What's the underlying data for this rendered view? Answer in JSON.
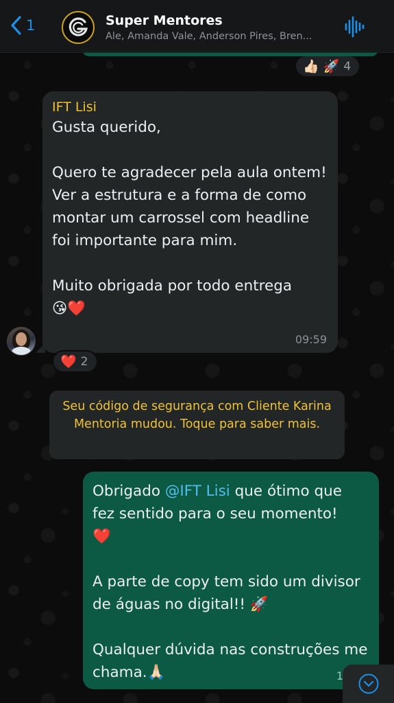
{
  "header": {
    "back_count": "1",
    "group_name": "Super Mentores",
    "participants": "Ale, Amanda Vale, Anderson Pires, Bren...",
    "colors": {
      "accent": "#1e90e8",
      "gold": "#c9a227"
    }
  },
  "top_reaction": {
    "emojis": "👍🏻 🚀",
    "count": "4"
  },
  "incoming_message": {
    "sender": "IFT Lisi",
    "text": "Gusta querido,\n\nQuero te agradecer pela aula ontem!\nVer a estrutura e a forma de como montar um carrossel com headline foi importante para mim.\n\nMuito obrigada por todo entrega\n😘❤️",
    "time": "09:59",
    "sender_color": "#f2c233"
  },
  "incoming_reaction": {
    "emoji": "❤️",
    "count": "2"
  },
  "system_note": {
    "text": "Seu código de segurança com Cliente Karina Mentoria mudou. Toque para saber mais."
  },
  "outgoing_message": {
    "prefix": "Obrigado ",
    "mention": "@IFT Lisi",
    "text": " que ótimo que fez sentido para o seu momento!\n❤️\n\nA parte de copy tem sido um divisor de águas no digital!! 🚀\n\nQualquer dúvida nas construções me chama.🙏🏻",
    "time": "12:30",
    "bubble_color": "#0d5a44"
  },
  "icons": {
    "back": "chevron-left-icon",
    "group_avatar": "g-logo-icon",
    "audio": "waveform-icon",
    "scroll_down": "chevron-down-circle-icon"
  }
}
